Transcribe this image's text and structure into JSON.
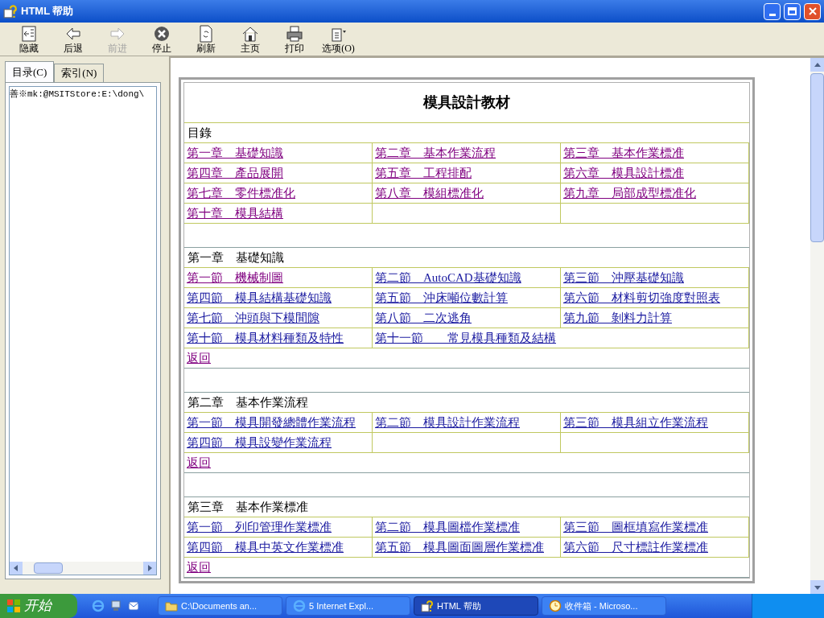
{
  "window": {
    "title": "HTML 帮助"
  },
  "toolbar": [
    {
      "label": "隐藏",
      "disabled": false
    },
    {
      "label": "后退",
      "disabled": false
    },
    {
      "label": "前进",
      "disabled": true
    },
    {
      "label": "停止",
      "disabled": false
    },
    {
      "label": "刷新",
      "disabled": false
    },
    {
      "label": "主页",
      "disabled": false
    },
    {
      "label": "打印",
      "disabled": false
    },
    {
      "label": "选项(O)",
      "disabled": false
    }
  ],
  "nav_tabs": [
    {
      "label": "目录(C)",
      "selected": true
    },
    {
      "label": "索引(N)",
      "selected": false
    }
  ],
  "tree_text": "善※mk:@MSITStore:E:\\dong\\",
  "document": {
    "title": "模具設計教材",
    "sections": [
      {
        "heading": "目錄",
        "links": [
          {
            "text": "第一章　基礎知識",
            "visited": true
          },
          {
            "text": "第二章　基本作業流程",
            "visited": true
          },
          {
            "text": "第三章　基本作業標准",
            "visited": true
          },
          {
            "text": "第四章　產品展開",
            "visited": true
          },
          {
            "text": "第五章　工程排配",
            "visited": true
          },
          {
            "text": "第六章　模具設計標准",
            "visited": true
          },
          {
            "text": "第七章　零件標准化",
            "visited": true
          },
          {
            "text": "第八章　模組標准化",
            "visited": true
          },
          {
            "text": "第九章　局部成型標准化",
            "visited": true
          },
          {
            "text": "第十章　模具結構",
            "visited": true
          }
        ]
      },
      {
        "heading": "第一章　基礎知識",
        "links": [
          {
            "text": "第一節　機械制圖",
            "visited": true
          },
          {
            "text": "第二節　AutoCAD基礎知識",
            "visited": false
          },
          {
            "text": "第三節　沖壓基礎知識",
            "visited": false
          },
          {
            "text": "第四節　模具結構基礎知識",
            "visited": false
          },
          {
            "text": "第五節　沖床噸位數計算",
            "visited": false
          },
          {
            "text": "第六節　材料剪切強度對照表",
            "visited": false
          },
          {
            "text": "第七節　沖頭與下模間隙",
            "visited": false
          },
          {
            "text": "第八節　二次逃角",
            "visited": false
          },
          {
            "text": "第九節　剝料力計算",
            "visited": false
          },
          {
            "text": "第十節　模具材料種類及特性",
            "visited": false
          },
          {
            "text": "第十一節　　常見模具種類及結構",
            "visited": false
          }
        ],
        "back": {
          "text": "返回",
          "visited": true
        }
      },
      {
        "heading": "第二章　基本作業流程",
        "links": [
          {
            "text": "第一節　模具開發總體作業流程",
            "visited": false
          },
          {
            "text": "第二節　模具設計作業流程",
            "visited": false
          },
          {
            "text": "第三節　模具組立作業流程",
            "visited": false
          },
          {
            "text": "第四節　模具設變作業流程",
            "visited": false
          }
        ],
        "back": {
          "text": "返回",
          "visited": true
        }
      },
      {
        "heading": "第三章　基本作業標准",
        "links": [
          {
            "text": "第一節　列印管理作業標准",
            "visited": false
          },
          {
            "text": "第二節　模具圖檔作業標准",
            "visited": false
          },
          {
            "text": "第三節　圖框填寫作業標准",
            "visited": false
          },
          {
            "text": "第四節　模具中英文作業標准",
            "visited": false
          },
          {
            "text": "第五節　模具圖面圖層作業標准",
            "visited": false
          },
          {
            "text": "第六節　尺寸標註作業標准",
            "visited": false
          }
        ],
        "back": {
          "text": "返回",
          "visited": true
        }
      }
    ]
  },
  "taskbar": {
    "start": "开始",
    "tasks": [
      {
        "label": "C:\\Documents an...",
        "selected": false
      },
      {
        "label": "5 Internet Expl...",
        "selected": false
      },
      {
        "label": "HTML 帮助",
        "selected": true
      },
      {
        "label": "收件箱 - Microso...",
        "selected": false
      }
    ]
  }
}
